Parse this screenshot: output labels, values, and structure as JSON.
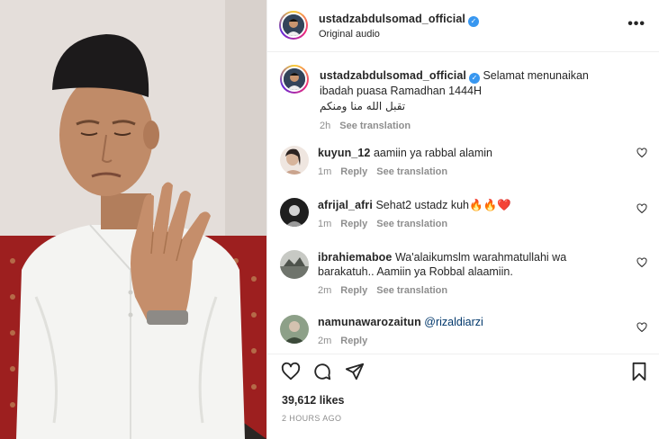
{
  "post": {
    "username": "ustadzabdulsomad_official",
    "audio": "Original audio",
    "more_label": "•••"
  },
  "caption": {
    "username": "ustadzabdulsomad_official",
    "text": "Selamat menunaikan ibadah puasa Ramadhan 1444H",
    "arabic": "تقبل الله منا ومنكم",
    "time": "2h",
    "see_translation": "See translation"
  },
  "comments": [
    {
      "username": "kuyun_12",
      "text": "aamiin ya rabbal alamin",
      "time": "1m",
      "reply": "Reply",
      "see_translation": "See translation",
      "avatar_color": "#c9b8ad"
    },
    {
      "username": "afrijal_afri",
      "text": "Sehat2 ustadz kuh🔥🔥❤️",
      "time": "1m",
      "reply": "Reply",
      "see_translation": "See translation",
      "avatar_color": "#222222"
    },
    {
      "username": "ibrahiemaboe",
      "text": "Wa'alaikumslm warahmatullahi wa barakatuh.. Aamiin ya Robbal alaamiin.",
      "time": "2m",
      "reply": "Reply",
      "see_translation": "See translation",
      "avatar_color": "#8a8f88"
    },
    {
      "username": "namunawarozaitun",
      "mention": "@rizaldiarzi",
      "time": "2m",
      "reply": "Reply",
      "avatar_color": "#5c6b56"
    }
  ],
  "stats": {
    "likes": "39,612 likes",
    "time_ago": "2 HOURS AGO"
  },
  "icons": {
    "like": "heart-icon",
    "comment": "comment-icon",
    "share": "share-icon",
    "save": "bookmark-icon"
  },
  "colors": {
    "verified": "#3897f0",
    "secondary_text": "#8e8e8e",
    "mention": "#00376b"
  }
}
